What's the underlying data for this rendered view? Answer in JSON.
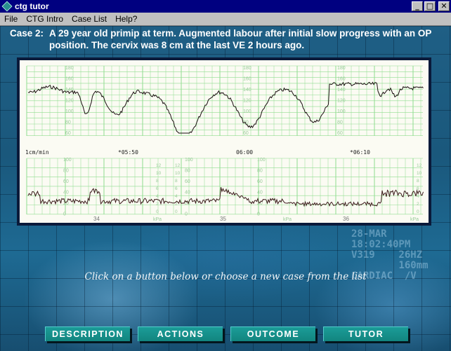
{
  "window": {
    "title": "ctg tutor",
    "controls": {
      "minimize": "_",
      "maximize": "□",
      "close": "✕"
    }
  },
  "menu": [
    "File",
    "CTG Intro",
    "Case List",
    "Help?"
  ],
  "case": {
    "label": "Case 2:",
    "description": "A 29 year old primip at term. Augmented labour after initial slow progress with an OP position. The cervix was 8 cm at the last VE 2 hours ago."
  },
  "ctg": {
    "fhr_scale_labels": [
      "180",
      "160",
      "140",
      "120",
      "100",
      "80",
      "60"
    ],
    "toco_scale_labels": [
      "100",
      "80",
      "60",
      "40",
      "20",
      "0"
    ],
    "kpa_scale_labels": [
      "12",
      "10",
      "8",
      "6",
      "4",
      "2",
      "0"
    ],
    "time_marks": [
      "*05:50",
      "06:00",
      "*06:10"
    ],
    "speed_label": "1cm/min",
    "page_numbers": [
      "34",
      "35",
      "36"
    ],
    "kpa_unit": "kPa"
  },
  "background_monitor_text": "28-MAR\n18:02:40PM\nV319    26HZ\n        160mm\nCARDIAC  /V",
  "instruction": "Click on a button below or choose a new case from the list",
  "buttons": [
    "DESCRIPTION",
    "ACTIONS",
    "OUTCOME",
    "TUTOR"
  ]
}
